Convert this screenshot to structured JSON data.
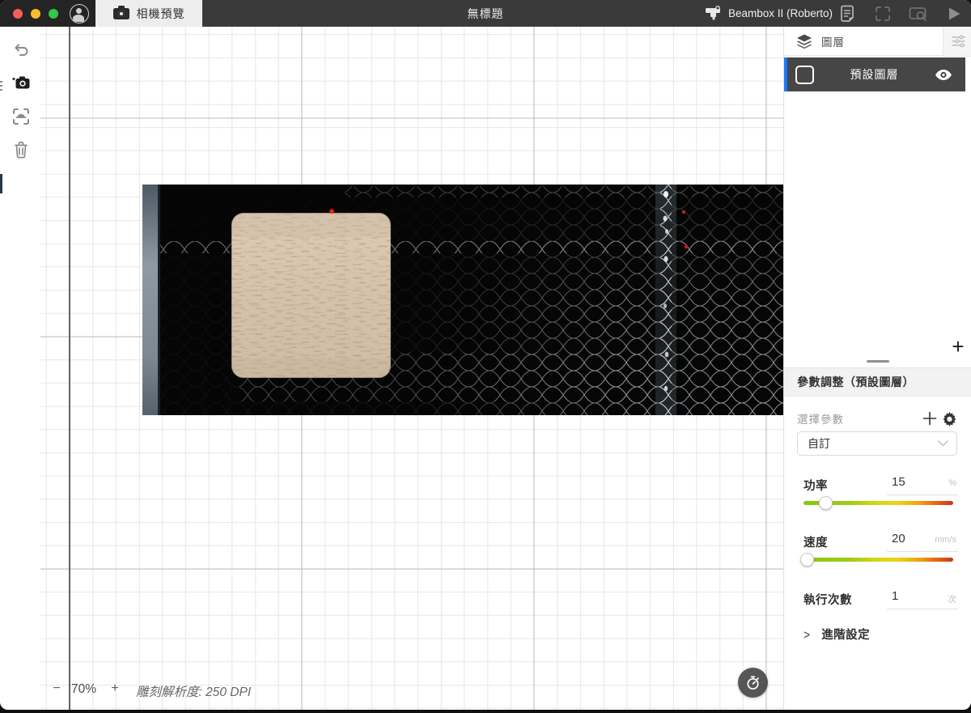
{
  "titlebar": {
    "tab_label": "相機預覽",
    "title": "無標題",
    "device_name": "Beambox II (Roberto)"
  },
  "layers_panel": {
    "header": "圖層",
    "layer_name": "預設圖層",
    "add_label": "+"
  },
  "params_panel": {
    "title": "參數調整（預設圖層）",
    "select_label": "選擇參數",
    "preset_value": "自訂",
    "power": {
      "label": "功率",
      "value": "15",
      "unit": "%"
    },
    "speed": {
      "label": "速度",
      "value": "20",
      "unit": "mm/s"
    },
    "passes": {
      "label": "執行次數",
      "value": "1",
      "unit": "次"
    },
    "advanced_label": "進階設定",
    "advanced_chevron": ">"
  },
  "statusbar": {
    "zoom_out": "−",
    "zoom_level": "70%",
    "zoom_in": "+",
    "resolution": "雕刻解析度: 250 DPI"
  },
  "icons": {
    "titlebar": [
      "close",
      "minimize",
      "maximize",
      "account",
      "camera",
      "machine",
      "document-settings",
      "frame",
      "camera-preview",
      "play"
    ],
    "toolbar": [
      "undo",
      "camera-add",
      "trace",
      "trash"
    ],
    "panel": [
      "layers",
      "adjust-sliders",
      "checkbox",
      "eye",
      "add",
      "gear",
      "chevron-down",
      "timer"
    ]
  },
  "colors": {
    "accent_blue": "#1677ff",
    "layer_row_bg": "#464646",
    "titlebar_bg": "#3a3a3a",
    "slider_green": "#84c813",
    "slider_red": "#cd3517"
  }
}
